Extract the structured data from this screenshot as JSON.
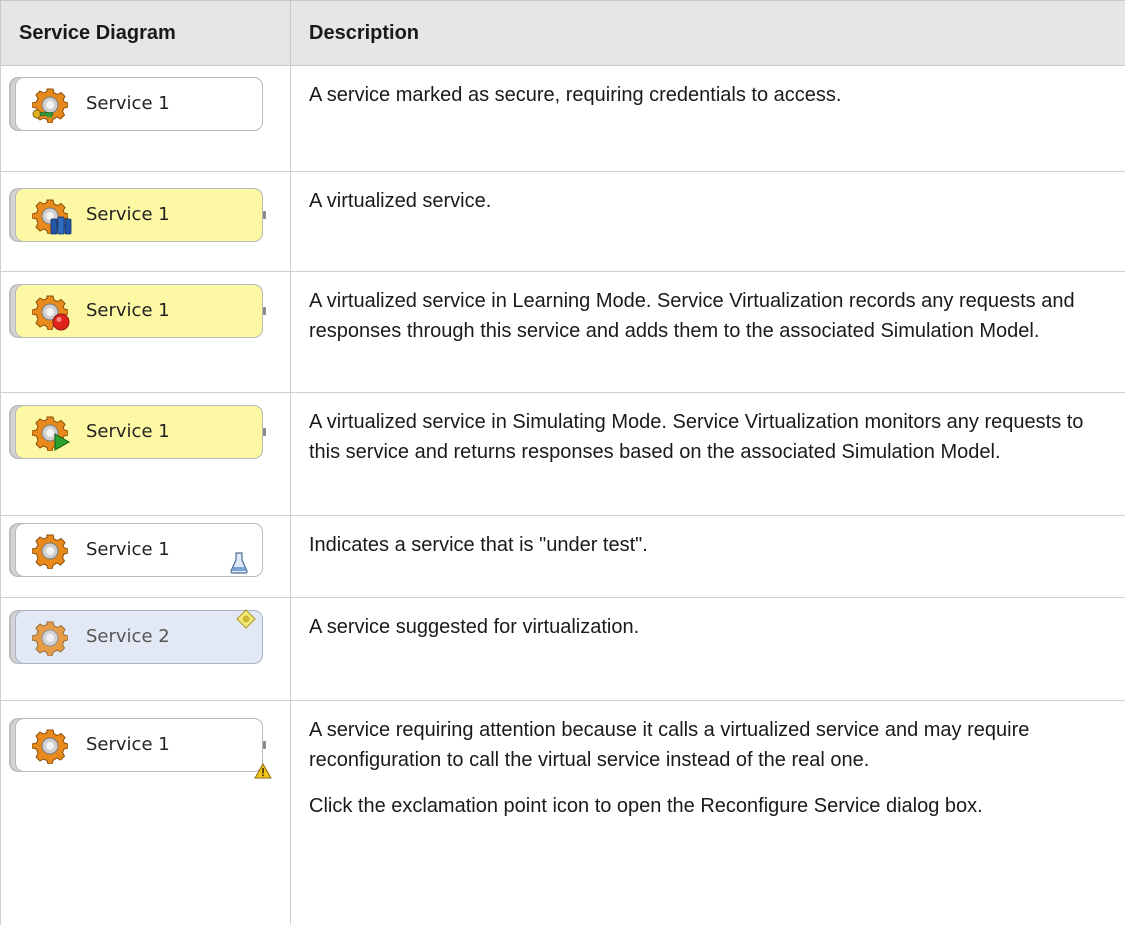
{
  "table": {
    "headers": [
      "Service Diagram",
      "Description"
    ],
    "rows": [
      {
        "node_label": "Service 1",
        "node_style": "white",
        "overlay_icon": "key-icon",
        "description": [
          "A service marked as secure, requiring credentials to access."
        ]
      },
      {
        "node_label": "Service 1",
        "node_style": "yellow",
        "overlay_icon": "virtual-servers-icon",
        "description": [
          "A virtualized service."
        ]
      },
      {
        "node_label": "Service 1",
        "node_style": "yellow",
        "overlay_icon": "record-icon",
        "description": [
          "A virtualized service in Learning Mode. Service Virtualization records any requests and responses through this service and adds them to the associated Simulation Model."
        ]
      },
      {
        "node_label": "Service 1",
        "node_style": "yellow",
        "overlay_icon": "play-icon",
        "description": [
          "A virtualized service in Simulating Mode. Service Virtualization monitors any requests to this service and returns responses based on the associated Simulation Model."
        ]
      },
      {
        "node_label": "Service 1",
        "node_style": "white",
        "overlay_icon": "flask-icon",
        "description": [
          "Indicates a service that is \"under test\"."
        ]
      },
      {
        "node_label": "Service 2",
        "node_style": "blue",
        "overlay_icon": "suggestion-diamond-icon",
        "description": [
          "A service suggested for virtualization."
        ]
      },
      {
        "node_label": "Service 1",
        "node_style": "white",
        "overlay_icon": "warning-icon",
        "description": [
          "A service requiring attention because it calls a virtualized service and may require reconfiguration to call the virtual service instead of the real one.",
          "Click the exclamation point icon to open the Reconfigure Service dialog box."
        ]
      }
    ]
  },
  "colors": {
    "header_bg": "#e6e6e6",
    "virtualized_node": "#fcf8a4",
    "suggested_node": "#e2e9f4",
    "gear_orange": "#e8891c",
    "border": "#cfcfcf"
  }
}
